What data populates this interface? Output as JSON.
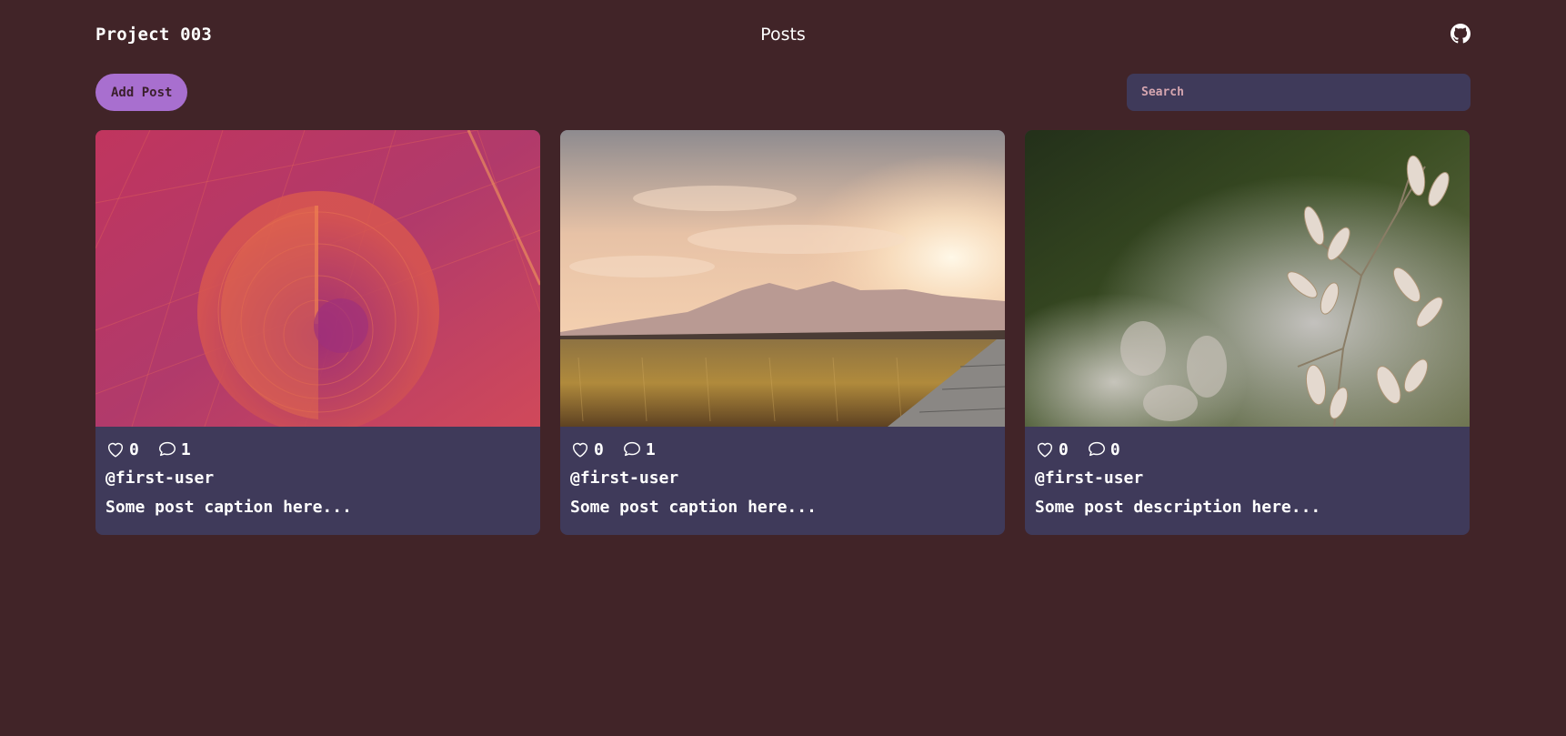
{
  "header": {
    "brand": "Project 003",
    "title": "Posts",
    "github_icon": "github-icon"
  },
  "toolbar": {
    "add_label": "Add Post",
    "search_placeholder": "Search"
  },
  "posts": [
    {
      "likes": "0",
      "comments": "1",
      "user": "@first-user",
      "caption": "Some post caption here...",
      "image": "abstract-spiral"
    },
    {
      "likes": "0",
      "comments": "1",
      "user": "@first-user",
      "caption": "Some post caption here...",
      "image": "sunset-field"
    },
    {
      "likes": "0",
      "comments": "0",
      "user": "@first-user",
      "caption": "Some post description here...",
      "image": "grass-flower"
    }
  ]
}
